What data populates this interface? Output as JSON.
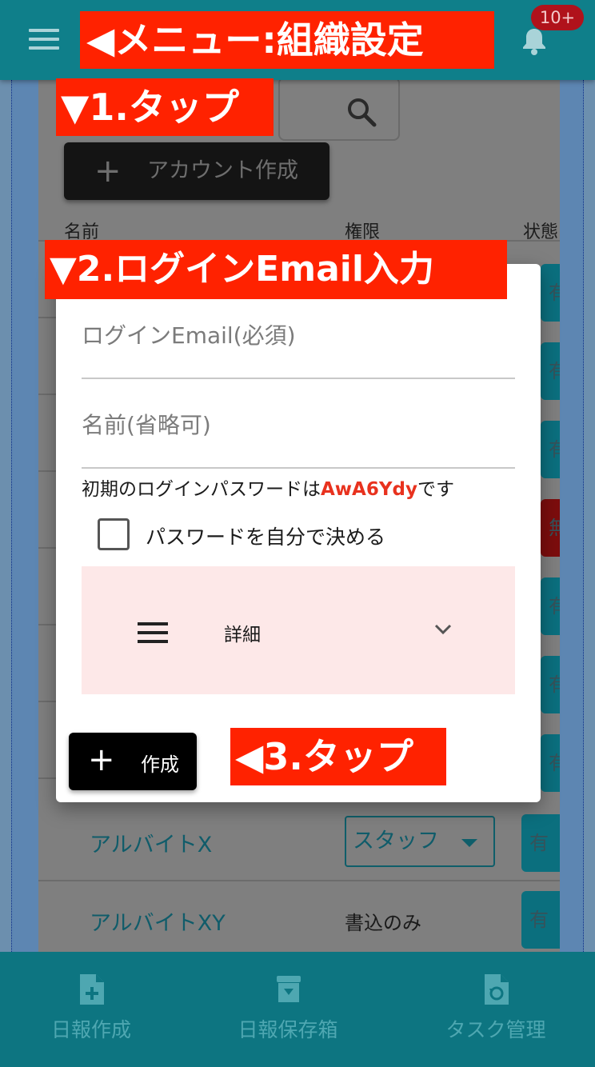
{
  "topbar": {
    "notification_count": "10+",
    "callout_menu": "◀メニュー:組織設定"
  },
  "toolbar": {
    "callout_tap1": "▼1.タップ",
    "add_account_label": "アカウント作成"
  },
  "table": {
    "headers": [
      "名前",
      "権限",
      "状態"
    ],
    "rows": [
      {
        "name": "アルバイトX",
        "role": "スタッフ",
        "status": "有"
      },
      {
        "name": "アルバイトXY",
        "role": "書込のみ",
        "status": "有"
      }
    ],
    "status_chips": [
      "有",
      "有",
      "有",
      "無",
      "有",
      "有",
      "有"
    ]
  },
  "modal": {
    "callout_email": "▼2.ログインEmail入力",
    "email_placeholder": "ログインEmail(必須)",
    "name_placeholder": "名前(省略可)",
    "notice_prefix": "初期のログインパスワードは",
    "password": "AwA6Ydy",
    "notice_suffix": "です",
    "checkbox_label": "パスワードを自分で決める",
    "details_label": "詳細",
    "create_label": "作成",
    "callout_tap3": "◀3.タップ"
  },
  "bottom_nav": [
    {
      "label": "日報作成",
      "icon": "file-plus-icon"
    },
    {
      "label": "日報保存箱",
      "icon": "archive-box-icon"
    },
    {
      "label": "タスク管理",
      "icon": "file-refresh-icon"
    }
  ],
  "colors": {
    "topbar": "#0f7f8a",
    "callout": "#ff2200",
    "password": "#e8321e",
    "bottom_nav": "#0d7581"
  }
}
